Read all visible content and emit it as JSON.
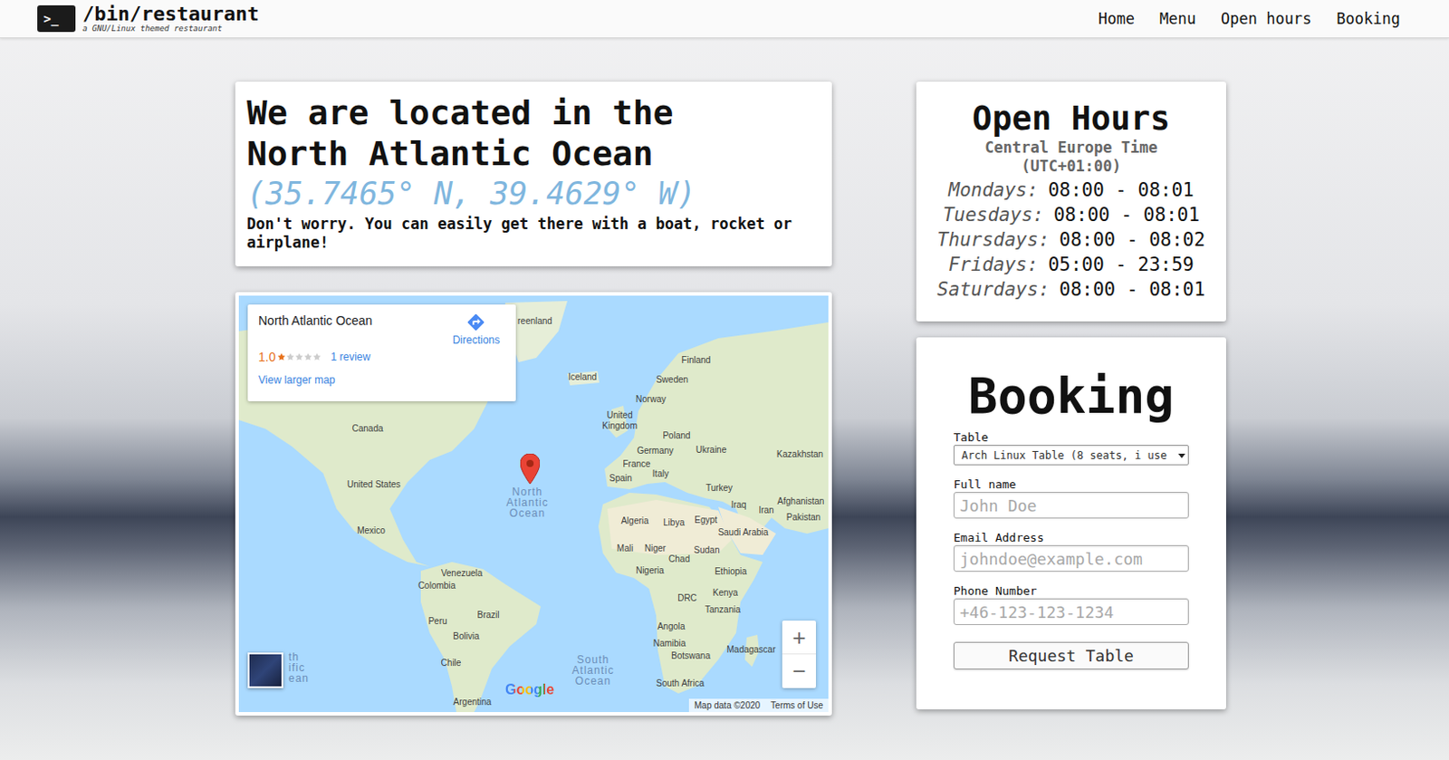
{
  "nav": {
    "logo_glyph": ">_",
    "title": "/bin/restaurant",
    "subtitle": "a GNU/Linux themed restaurant",
    "links": [
      {
        "label": "Home"
      },
      {
        "label": "Menu"
      },
      {
        "label": "Open hours"
      },
      {
        "label": "Booking"
      }
    ]
  },
  "location": {
    "title_lines": [
      "We are located in the",
      "North Atlantic Ocean"
    ],
    "coordinates": "(35.7465° N, 39.4629° W)",
    "note": "Don't worry. You can easily get there with a boat, rocket or airplane!"
  },
  "map": {
    "info": {
      "title": "North Atlantic Ocean",
      "directions": "Directions",
      "rating": "1.0",
      "stars": 1,
      "reviews": "1 review",
      "larger_map": "View larger map"
    },
    "labels": [
      {
        "text": "reenland",
        "kind": "land"
      },
      {
        "text": "Iceland",
        "kind": "land"
      },
      {
        "text": "Finland",
        "kind": "land"
      },
      {
        "text": "Sweden",
        "kind": "land"
      },
      {
        "text": "Norway",
        "kind": "land"
      },
      {
        "text": "United\nKingdom",
        "kind": "land"
      },
      {
        "text": "Poland",
        "kind": "land"
      },
      {
        "text": "Germany",
        "kind": "land"
      },
      {
        "text": "Ukraine",
        "kind": "land"
      },
      {
        "text": "Kazakhstan",
        "kind": "land"
      },
      {
        "text": "France",
        "kind": "land"
      },
      {
        "text": "Italy",
        "kind": "land"
      },
      {
        "text": "Spain",
        "kind": "land"
      },
      {
        "text": "Turkey",
        "kind": "land"
      },
      {
        "text": "Iraq",
        "kind": "land"
      },
      {
        "text": "Iran",
        "kind": "land"
      },
      {
        "text": "Afghanistan",
        "kind": "land"
      },
      {
        "text": "Pakistan",
        "kind": "land"
      },
      {
        "text": "Canada",
        "kind": "land"
      },
      {
        "text": "United States",
        "kind": "land"
      },
      {
        "text": "Mexico",
        "kind": "land"
      },
      {
        "text": "North\nAtlantic\nOcean",
        "kind": "ocean"
      },
      {
        "text": "Algeria",
        "kind": "land"
      },
      {
        "text": "Libya",
        "kind": "land"
      },
      {
        "text": "Egypt",
        "kind": "land"
      },
      {
        "text": "Saudi Arabia",
        "kind": "land"
      },
      {
        "text": "Mali",
        "kind": "land"
      },
      {
        "text": "Niger",
        "kind": "land"
      },
      {
        "text": "Chad",
        "kind": "land"
      },
      {
        "text": "Sudan",
        "kind": "land"
      },
      {
        "text": "Nigeria",
        "kind": "land"
      },
      {
        "text": "Ethiopia",
        "kind": "land"
      },
      {
        "text": "Venezuela",
        "kind": "land"
      },
      {
        "text": "Colombia",
        "kind": "land"
      },
      {
        "text": "Kenya",
        "kind": "land"
      },
      {
        "text": "DRC",
        "kind": "land"
      },
      {
        "text": "Tanzania",
        "kind": "land"
      },
      {
        "text": "Brazil",
        "kind": "land"
      },
      {
        "text": "Peru",
        "kind": "land"
      },
      {
        "text": "Bolivia",
        "kind": "land"
      },
      {
        "text": "Angola",
        "kind": "land"
      },
      {
        "text": "Namibia",
        "kind": "land"
      },
      {
        "text": "Botswana",
        "kind": "land"
      },
      {
        "text": "Madagascar",
        "kind": "land"
      },
      {
        "text": "Chile",
        "kind": "land"
      },
      {
        "text": "South\nAtlantic\nOcean",
        "kind": "ocean"
      },
      {
        "text": "South Africa",
        "kind": "land"
      },
      {
        "text": "Argentina",
        "kind": "land"
      },
      {
        "text": "th\nific\nean",
        "kind": "ocean"
      }
    ],
    "zoom_in": "+",
    "zoom_out": "−",
    "logo": "Google",
    "attribution": "Map data ©2020",
    "terms": "Terms of Use"
  },
  "hours": {
    "title": "Open Hours",
    "timezone_lines": [
      "Central Europe Time",
      "(UTC+01:00)"
    ],
    "rows": [
      {
        "day": "Mondays:",
        "time": "08:00 - 08:01"
      },
      {
        "day": "Tuesdays:",
        "time": "08:00 - 08:01"
      },
      {
        "day": "Thursdays:",
        "time": "08:00 - 08:02"
      },
      {
        "day": "Fridays:",
        "time": "05:00 - 23:59"
      },
      {
        "day": "Saturdays:",
        "time": "08:00 - 08:01"
      }
    ]
  },
  "booking": {
    "title": "Booking",
    "fields": [
      {
        "kind": "select",
        "label": "Table",
        "value": "Arch Linux Table (8 seats, i use"
      },
      {
        "kind": "input",
        "label": "Full name",
        "placeholder": "John Doe"
      },
      {
        "kind": "input",
        "label": "Email Address",
        "placeholder": "johndoe@example.com"
      },
      {
        "kind": "input",
        "label": "Phone Number",
        "placeholder": "+46-123-123-1234"
      }
    ],
    "button": "Request Table"
  }
}
